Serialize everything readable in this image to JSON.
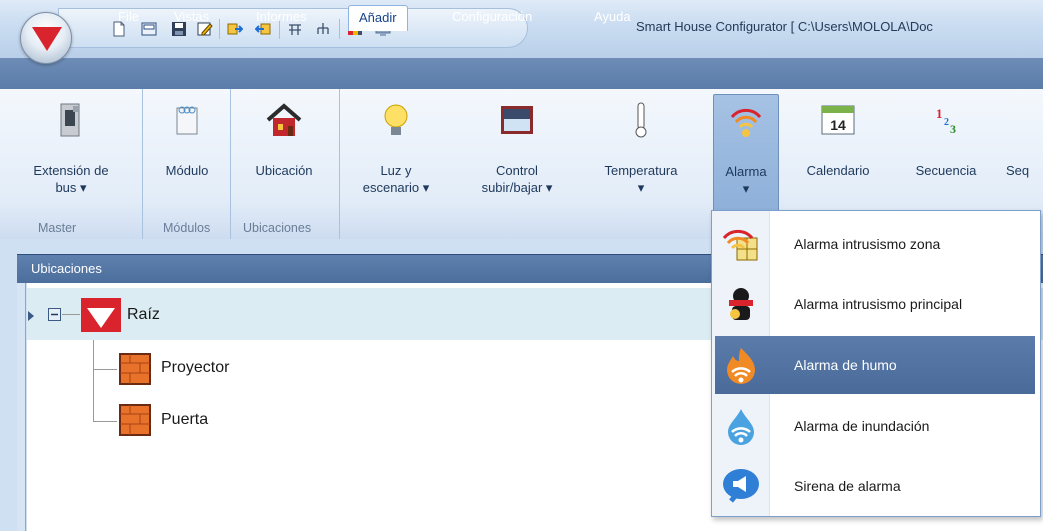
{
  "window": {
    "title": "Smart House Configurator [ C:\\Users\\MOLOLA\\Doc"
  },
  "tabs": [
    {
      "label": "File"
    },
    {
      "label": "Vistas"
    },
    {
      "label": "Informes"
    },
    {
      "label": "Añadir",
      "active": true
    },
    {
      "label": "Configuración"
    },
    {
      "label": "Ayuda"
    }
  ],
  "ribbon": {
    "buttons": [
      {
        "line1": "Extensión de",
        "line2": "bus ▾",
        "icon": "bus-extension-icon"
      },
      {
        "line1": "Módulo",
        "line2": "",
        "icon": "module-icon"
      },
      {
        "line1": "Ubicación",
        "line2": "",
        "icon": "house-icon"
      },
      {
        "line1": "Luz y",
        "line2": "escenario ▾",
        "icon": "lightbulb-icon"
      },
      {
        "line1": "Control",
        "line2": "subir/bajar ▾",
        "icon": "window-blind-icon"
      },
      {
        "line1": "Temperatura",
        "line2": "▾",
        "icon": "thermometer-icon"
      },
      {
        "line1": "Alarma",
        "line2": "▾",
        "icon": "alarm-icon",
        "pressed": true
      },
      {
        "line1": "Calendario",
        "line2": "",
        "icon": "calendar-icon",
        "calendar_day": "14"
      },
      {
        "line1": "Secuencia",
        "line2": "",
        "icon": "sequence-icon"
      },
      {
        "line1": "Seq",
        "line2": "",
        "icon": "sequence-icon"
      }
    ],
    "groups": [
      {
        "label": "Master"
      },
      {
        "label": "Módulos"
      },
      {
        "label": "Ubicaciones"
      }
    ]
  },
  "panel": {
    "title": "Ubicaciones",
    "tree": {
      "root": "Raíz",
      "children": [
        "Proyector",
        "Puerta"
      ]
    }
  },
  "dropdown": {
    "items": [
      {
        "label": "Alarma intrusismo zona",
        "icon": "zone-intrusion-alarm-icon"
      },
      {
        "label": "Alarma intrusismo principal",
        "icon": "burglar-alarm-icon"
      },
      {
        "label": "Alarma de humo",
        "icon": "smoke-alarm-icon",
        "highlighted": true
      },
      {
        "label": "Alarma de inundación",
        "icon": "flood-alarm-icon"
      },
      {
        "label": "Sirena de alarma",
        "icon": "siren-icon"
      }
    ]
  },
  "colors": {
    "brand_red": "#d9232d",
    "highlight": "#4f709f",
    "tree_selected_row": "#dbedf3"
  }
}
